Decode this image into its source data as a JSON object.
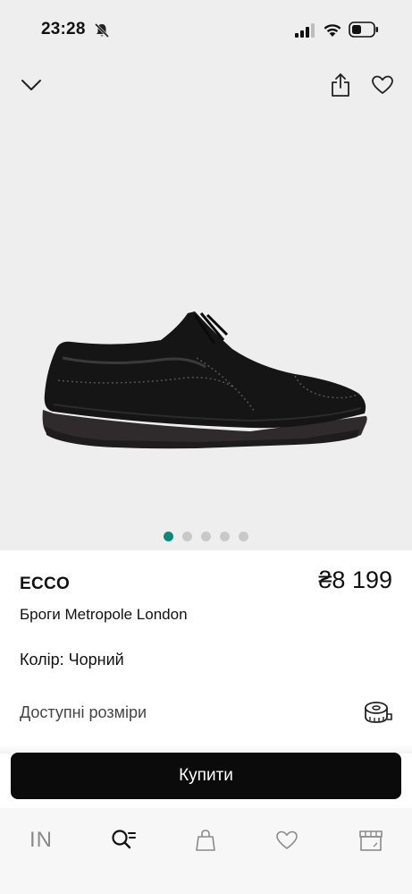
{
  "status_bar": {
    "time": "23:28"
  },
  "product": {
    "brand": "ECCO",
    "price": "₴8 199",
    "name": "Броги Metropole London",
    "color_label": "Колір:",
    "color_value": "Чорний",
    "gallery": {
      "total_images": 5,
      "active_index": 0
    }
  },
  "sizes": {
    "label": "Доступні розміри"
  },
  "actions": {
    "buy_label": "Купити"
  },
  "tabbar": {
    "home_label": "IN"
  },
  "colors": {
    "hero_background": "#eeeeee",
    "active_dot": "#0a8a7a",
    "buy_button": "#0b0b0b",
    "tabbar_background": "#f7f7f7"
  }
}
